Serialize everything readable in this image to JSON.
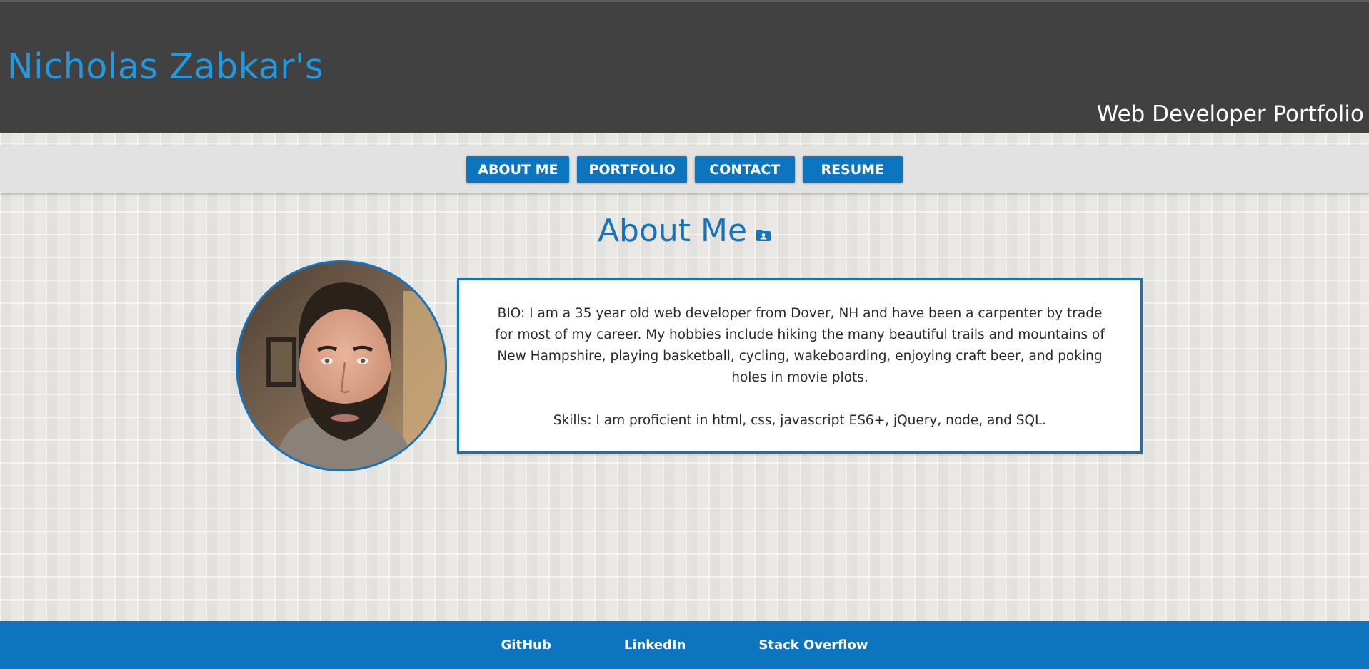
{
  "header": {
    "title": "Nicholas Zabkar's",
    "subtitle": "Web Developer Portfolio"
  },
  "nav": {
    "items": [
      {
        "label": "About Me"
      },
      {
        "label": "Portfolio"
      },
      {
        "label": "Contact"
      },
      {
        "label": "Resume"
      }
    ]
  },
  "main": {
    "heading": "About Me",
    "heading_icon": "contact-card-folder-icon",
    "photo": "profile-photo",
    "bio": "BIO: I am a 35 year old web developer from Dover, NH and have been a carpenter by trade for most of my career. My hobbies include hiking the many beautiful trails and mountains of New Hampshire, playing basketball, cycling, wakeboarding, enjoying craft beer, and poking holes in movie plots.",
    "skills": "Skills: I am proficient in html, css, javascript ES6+, jQuery, node, and SQL."
  },
  "footer": {
    "links": [
      {
        "label": "GitHub"
      },
      {
        "label": "LinkedIn"
      },
      {
        "label": "Stack Overflow"
      }
    ]
  },
  "colors": {
    "header_bg": "#414141",
    "title": "#1e9be3",
    "accent_blue": "#0d74c0",
    "nav_bg": "#e2e2e2",
    "card_bg": "#ffffff"
  }
}
